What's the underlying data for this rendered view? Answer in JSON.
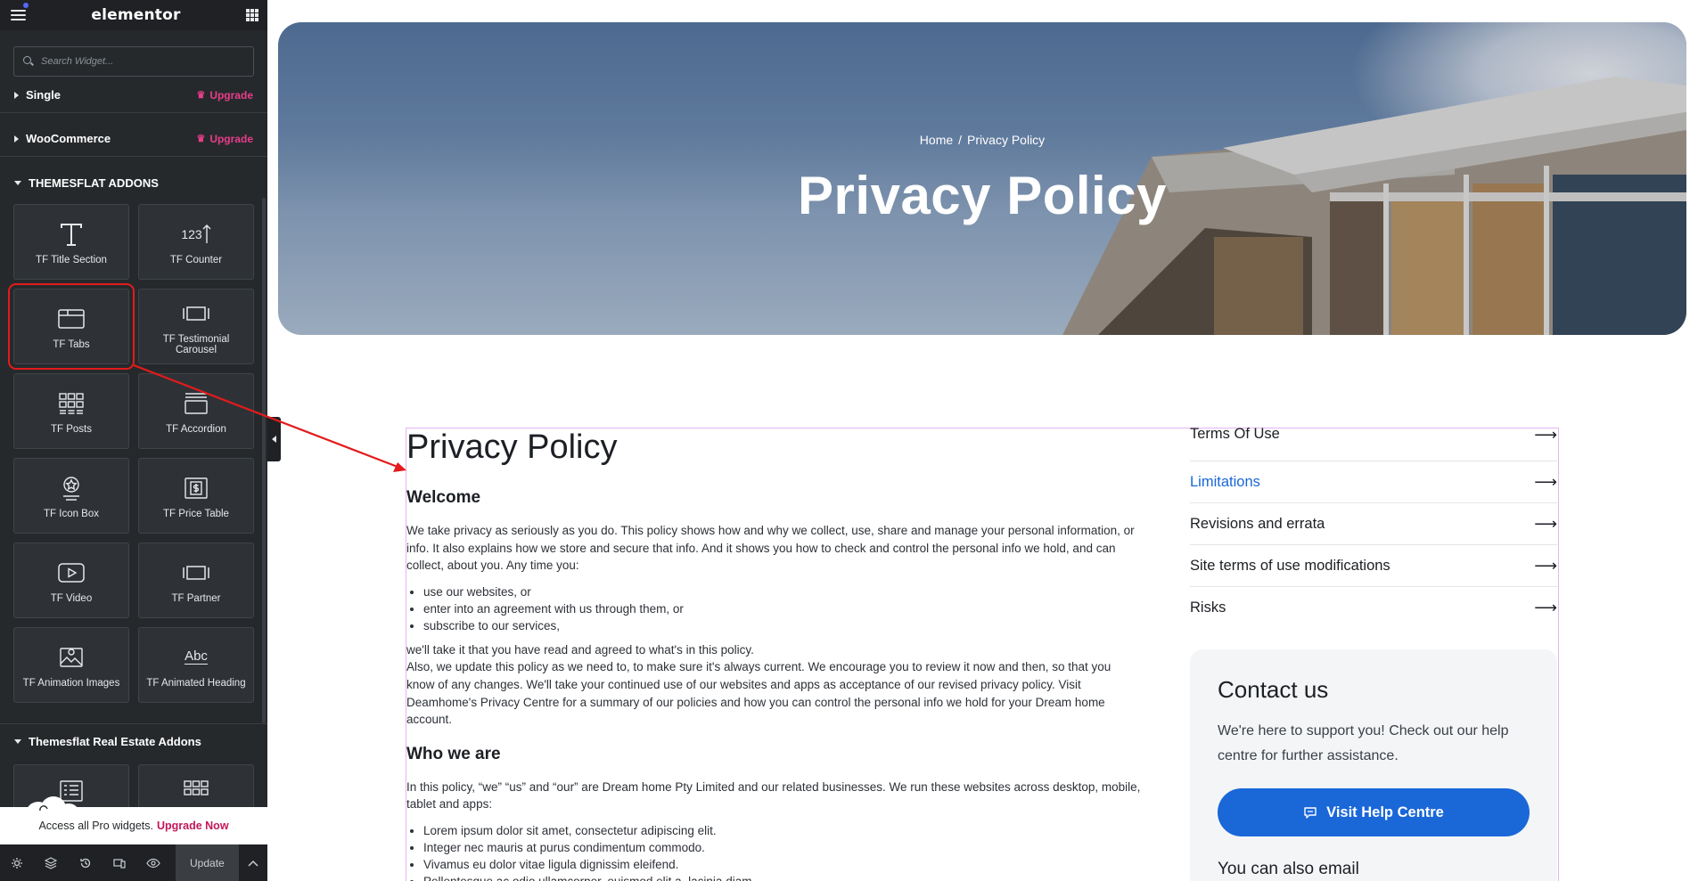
{
  "editor": {
    "logo": "elementor",
    "search_placeholder": "Search Widget...",
    "categories": [
      {
        "label": "Single",
        "upgrade": "Upgrade"
      },
      {
        "label": "WooCommerce",
        "upgrade": "Upgrade"
      }
    ],
    "addons_title": "THEMESFLAT ADDONS",
    "widgets": [
      {
        "label": "TF Title Section",
        "icon": "title-icon"
      },
      {
        "label": "TF Counter",
        "icon": "counter-icon"
      },
      {
        "label": "TF Tabs",
        "icon": "tabs-icon"
      },
      {
        "label": "TF Testimonial Carousel",
        "icon": "carousel-icon"
      },
      {
        "label": "TF Posts",
        "icon": "posts-grid-icon"
      },
      {
        "label": "TF Accordion",
        "icon": "accordion-icon"
      },
      {
        "label": "TF Icon Box",
        "icon": "icon-box-icon"
      },
      {
        "label": "TF Price Table",
        "icon": "price-table-icon"
      },
      {
        "label": "TF Video",
        "icon": "video-icon"
      },
      {
        "label": "TF Partner",
        "icon": "partner-icon"
      },
      {
        "label": "TF Animation Images",
        "icon": "image-icon"
      },
      {
        "label": "TF Animated Heading",
        "icon": "animated-heading-icon"
      }
    ],
    "counter_glyph": "123",
    "heading_glyph": "Abc",
    "real_estate_title": "Themesflat Real Estate Addons",
    "promo_text": "Access all Pro widgets.",
    "promo_link": "Upgrade Now",
    "update_label": "Update"
  },
  "page": {
    "breadcrumb": {
      "home": "Home",
      "separator": "/",
      "current": "Privacy Policy"
    },
    "hero_title": "Privacy Policy",
    "article": {
      "title": "Privacy Policy",
      "welcome_heading": "Welcome",
      "welcome_para": "We take privacy as seriously as you do. This policy shows how and why we collect, use, share and manage your personal information, or info. It also explains how we store and secure that info. And it shows you how to check and control the personal info we hold, and can collect, about you. Any time you:",
      "welcome_list": [
        "use our websites, or",
        "enter into an agreement with us through them, or",
        "subscribe to our services,"
      ],
      "after_list": "we'll take it that you have read and agreed to what's in this policy.",
      "update_para": "Also, we update this policy as we need to, to make sure it's always current. We encourage you to review it now and then, so that you know of any changes. We'll take your continued use of our websites and apps as acceptance of our revised privacy policy. Visit Deamhome's Privacy Centre for a summary of our policies and how you can control the personal info we hold for your Dream home account.",
      "who_heading": "Who we are",
      "who_para": "In this policy, “we” “us” and “our” are Dream home Pty Limited and our related businesses. We run these websites across desktop, mobile, tablet and apps:",
      "who_list": [
        "Lorem ipsum dolor sit amet, consectetur adipiscing elit.",
        "Integer nec mauris at purus condimentum commodo.",
        "Vivamus eu dolor vitae ligula dignissim eleifend.",
        "Pellentesque ac odio ullamcorper, euismod elit a, lacinia diam."
      ]
    },
    "side_links": [
      {
        "label": "Terms Of Use",
        "active": false
      },
      {
        "label": "Limitations",
        "active": true
      },
      {
        "label": "Revisions and errata",
        "active": false
      },
      {
        "label": "Site terms of use modifications",
        "active": false
      },
      {
        "label": "Risks",
        "active": false
      }
    ],
    "arrow_glyph": "⟶",
    "contact": {
      "title": "Contact us",
      "text": "We're here to support you! Check out our help centre for further assistance.",
      "button": "Visit Help Centre",
      "email_heading": "You can also email"
    }
  },
  "colors": {
    "sidebar_bg": "#26292c",
    "upgrade_pink": "#e73d8a",
    "accent_blue": "#1a67d8",
    "highlight_red": "#e31b1b",
    "frame_pink": "#e5b5f0"
  }
}
